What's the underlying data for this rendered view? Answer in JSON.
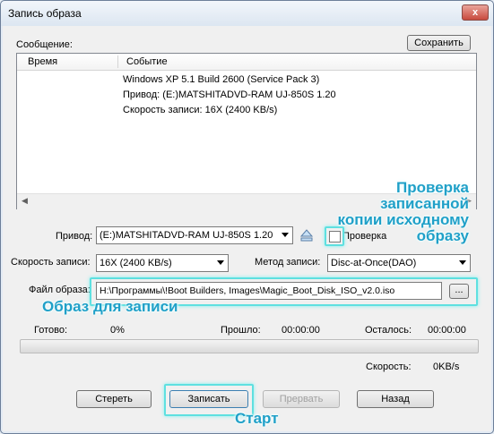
{
  "window": {
    "title": "Запись образа",
    "close_label": "x"
  },
  "message": {
    "label": "Сообщение:",
    "save_label": "Сохранить",
    "columns": [
      "Время",
      "Событие"
    ],
    "rows": [
      "Windows XP 5.1 Build 2600 (Service Pack 3)",
      "Привод: (E:)MATSHITADVD-RAM UJ-850S 1.20",
      "Скорость записи: 16X (2400 KB/s)"
    ]
  },
  "drive": {
    "label": "Привод:",
    "value": "(E:)MATSHITADVD-RAM UJ-850S 1.20",
    "verify_label": "Проверка",
    "verify_checked": false
  },
  "speed": {
    "label": "Скорость записи:",
    "value": "16X (2400 KB/s)"
  },
  "method": {
    "label": "Метод записи:",
    "value": "Disc-at-Once(DAO)"
  },
  "image_file": {
    "label": "Файл образа:",
    "value": "H:\\Программы\\!Boot Builders, Images\\Magic_Boot_Disk_ISO_v2.0.iso",
    "browse_label": "..."
  },
  "status": {
    "ready_label": "Готово:",
    "ready_value": "0%",
    "elapsed_label": "Прошло:",
    "elapsed_value": "00:00:00",
    "remaining_label": "Осталось:",
    "remaining_value": "00:00:00",
    "speed_label": "Скорость:",
    "speed_value": "0KB/s",
    "progress": 0
  },
  "buttons": {
    "erase": "Стереть",
    "write": "Записать",
    "abort": "Прервать",
    "back": "Назад"
  },
  "annotations": {
    "verify": "Проверка записанной\nкопии исходному\nобразу",
    "image": "Образ для записи",
    "start": "Старт"
  },
  "colors": {
    "highlight": "#5ee0e0",
    "annotation_text": "#1fa0c8"
  }
}
